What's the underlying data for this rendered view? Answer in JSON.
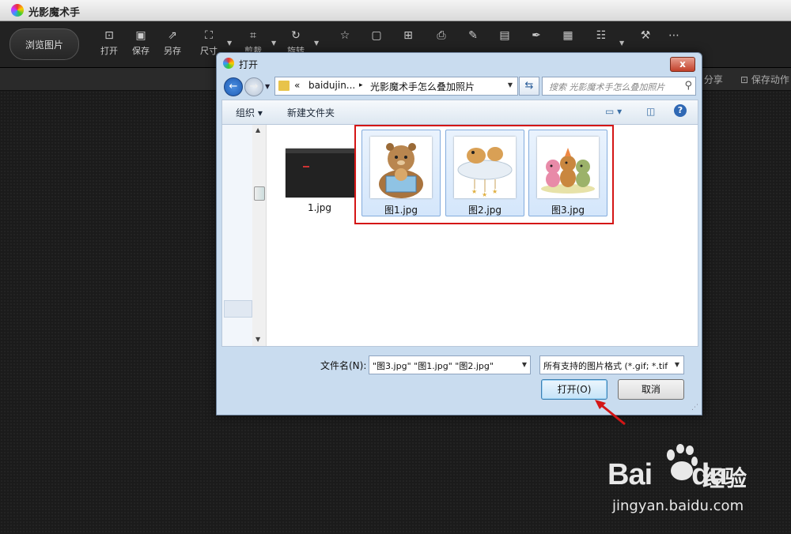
{
  "app": {
    "title": "光影魔术手"
  },
  "toolbar": {
    "browse_label": "浏览图片",
    "items": [
      {
        "label": "打开",
        "icon": "open-icon"
      },
      {
        "label": "保存",
        "icon": "save-icon"
      },
      {
        "label": "另存",
        "icon": "save-as-icon"
      },
      {
        "label": "尺寸",
        "icon": "resize-icon"
      },
      {
        "label": "剪裁",
        "icon": "crop-icon"
      },
      {
        "label": "旋转",
        "icon": "rotate-icon"
      },
      {
        "label": "",
        "icon": "frame-icon"
      },
      {
        "label": "",
        "icon": "border-icon"
      },
      {
        "label": "",
        "icon": "collage-icon"
      },
      {
        "label": "",
        "icon": "print-icon"
      },
      {
        "label": "",
        "icon": "brush-icon"
      },
      {
        "label": "",
        "icon": "calendar-icon"
      },
      {
        "label": "",
        "icon": "pen-icon"
      },
      {
        "label": "",
        "icon": "batch-icon"
      },
      {
        "label": "",
        "icon": "layout-icon"
      },
      {
        "label": "",
        "icon": "wrench-icon"
      },
      {
        "label": "",
        "icon": "more-icon"
      }
    ]
  },
  "subbar": {
    "share": "分享",
    "save_action": "保存动作"
  },
  "dialog": {
    "title": "打开",
    "close": "x",
    "breadcrumb": [
      "«",
      "baidujin...",
      "▸",
      "光影魔术手怎么叠加照片"
    ],
    "search_placeholder": "搜索 光影魔术手怎么叠加照片",
    "commands": {
      "organize": "组织 ▾",
      "new_folder": "新建文件夹"
    },
    "files": [
      {
        "name": "1.jpg",
        "selected": false
      },
      {
        "name": "图1.jpg",
        "selected": true
      },
      {
        "name": "图2.jpg",
        "selected": true
      },
      {
        "name": "图3.jpg",
        "selected": true
      }
    ],
    "filename_label": "文件名(N):",
    "filename_value": "\"图3.jpg\" \"图1.jpg\" \"图2.jpg\"",
    "filetype_value": "所有支持的图片格式 (*.gif; *.tif",
    "open_button": "打开(O)",
    "cancel_button": "取消"
  },
  "watermark": {
    "brand": "Bai",
    "brand_tail": "du",
    "cn": "经验",
    "url": "jingyan.baidu.com"
  },
  "colors": {
    "highlight_box": "#d41616",
    "selection": "#d4e6fb",
    "arrow": "#d41616"
  }
}
